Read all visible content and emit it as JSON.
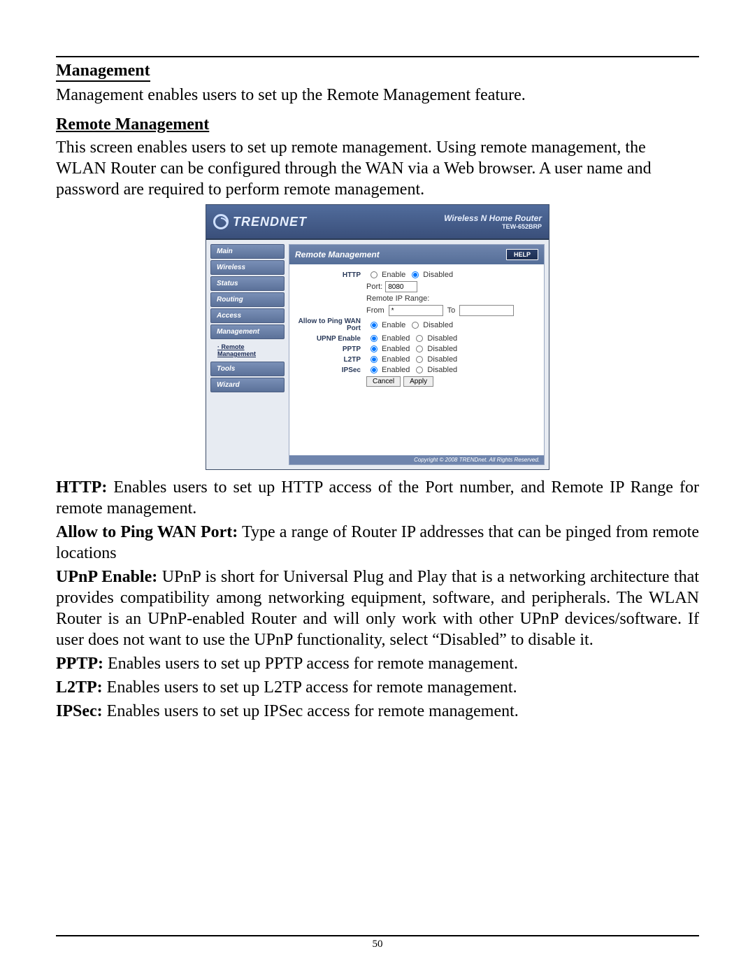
{
  "section_title": "Management",
  "intro": "Management enables users to set up the Remote Management feature.",
  "sub_title": "Remote Management",
  "sub_intro": "This screen enables users to set up remote management. Using remote management, the WLAN Router can be configured through the WAN via a Web browser. A user name and password are required to perform remote management.",
  "router": {
    "brand": "TRENDNET",
    "product": "Wireless N Home Router",
    "model": "TEW-652BRP",
    "nav": {
      "main": "Main",
      "wireless": "Wireless",
      "status": "Status",
      "routing": "Routing",
      "access": "Access",
      "management": "Management",
      "tools": "Tools",
      "wizard": "Wizard",
      "sub_active": "Remote Management"
    },
    "panel": {
      "title": "Remote Management",
      "help": "HELP",
      "labels": {
        "http": "HTTP",
        "port": "Port:",
        "remote_range": "Remote IP Range:",
        "from": "From",
        "to": "To",
        "ping": "Allow to Ping WAN Port",
        "upnp": "UPNP Enable",
        "pptp": "PPTP",
        "l2tp": "L2TP",
        "ipsec": "IPSec"
      },
      "options": {
        "enable": "Enable",
        "enabled": "Enabled",
        "disabled": "Disabled"
      },
      "values": {
        "port": "8080",
        "from": "*",
        "to": ""
      },
      "buttons": {
        "cancel": "Cancel",
        "apply": "Apply"
      },
      "copyright": "Copyright © 2008 TRENDnet. All Rights Reserved."
    }
  },
  "defs": {
    "http_k": "HTTP:",
    "http_v": " Enables users to set up HTTP access of the Port number, and Remote IP Range for remote management.",
    "ping_k": "Allow to Ping WAN Port:",
    "ping_v": " Type a range of Router IP addresses that can be pinged from remote locations",
    "upnp_k": "UPnP Enable:",
    "upnp_v": " UPnP is short for Universal Plug and Play that is a networking architecture that provides compatibility among networking equipment, software, and peripherals. The WLAN Router is an UPnP-enabled Router and will only work with other UPnP devices/software. If user does not want to use the UPnP functionality, select “Disabled” to disable it.",
    "pptp_k": "PPTP:",
    "pptp_v": " Enables users to set up PPTP access for remote management.",
    "l2tp_k": "L2TP:",
    "l2tp_v": " Enables users to set up L2TP access for remote management.",
    "ipsec_k": "IPSec:",
    "ipsec_v": " Enables users to set up IPSec access for remote management."
  },
  "page_number": "50"
}
